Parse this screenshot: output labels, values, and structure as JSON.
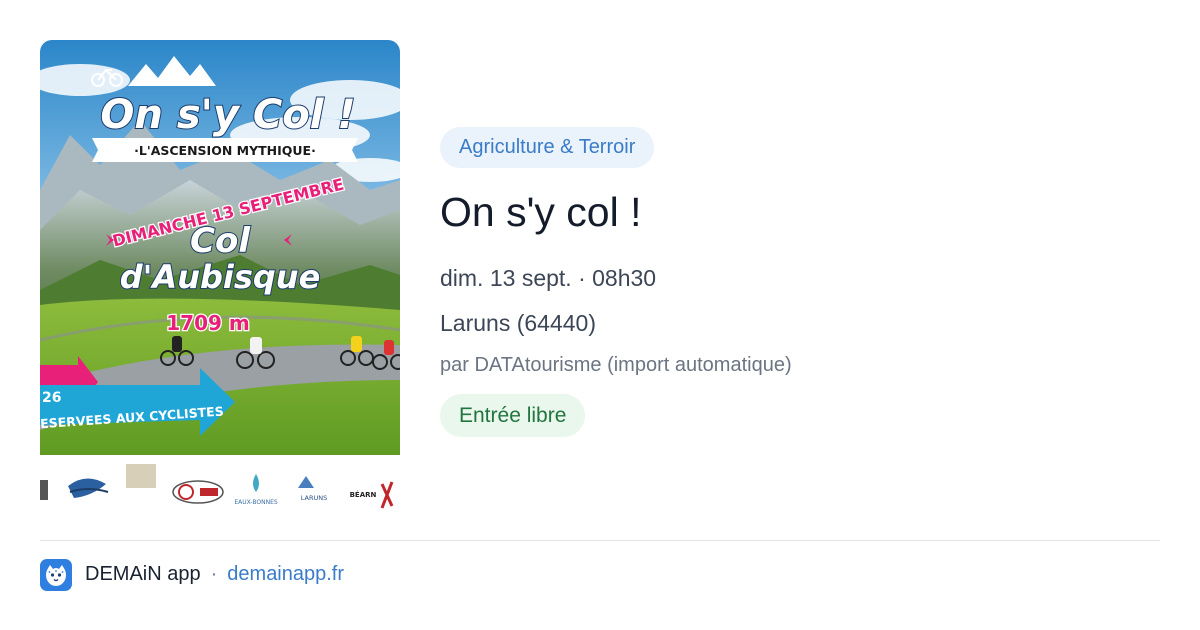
{
  "card": {
    "category": "Agriculture & Terroir",
    "title": "On s'y col !",
    "datetime": "dim. 13 sept. · 08h30",
    "location": "Laruns (64440)",
    "organizer": "par DATAtourisme (import automatique)",
    "price": "Entrée libre"
  },
  "poster": {
    "title": "On s'y Col !",
    "subtitle": "·L'ASCENSION MYTHIQUE·",
    "date": "DIMANCHE 13 SEPTEMBRE",
    "col_line1": "Col",
    "col_line2": "d'Aubisque",
    "altitude": "1709 m",
    "banner_number": "26",
    "banner_text": "ESERVEES AUX CYCLISTES",
    "sponsor_eaux_bonnes": "EAUX-BONNES",
    "sponsor_laruns": "LARUNS",
    "sponsor_bearn": "BÉARN"
  },
  "footer": {
    "app_name": "DEMAiN app",
    "separator": "·",
    "domain": "demainapp.fr"
  },
  "colors": {
    "category_bg": "#eaf2fb",
    "category_text": "#3a7cc8",
    "price_bg": "#e9f7ec",
    "price_text": "#23753f",
    "title_text": "#141b2b",
    "brand_blue": "#2f7fe0",
    "poster_pink": "#e8207a",
    "poster_cyan": "#1fa6d6"
  },
  "icons": {
    "app_logo": "demain-leopard-logo-icon",
    "poster_bike": "bicycle-icon"
  }
}
